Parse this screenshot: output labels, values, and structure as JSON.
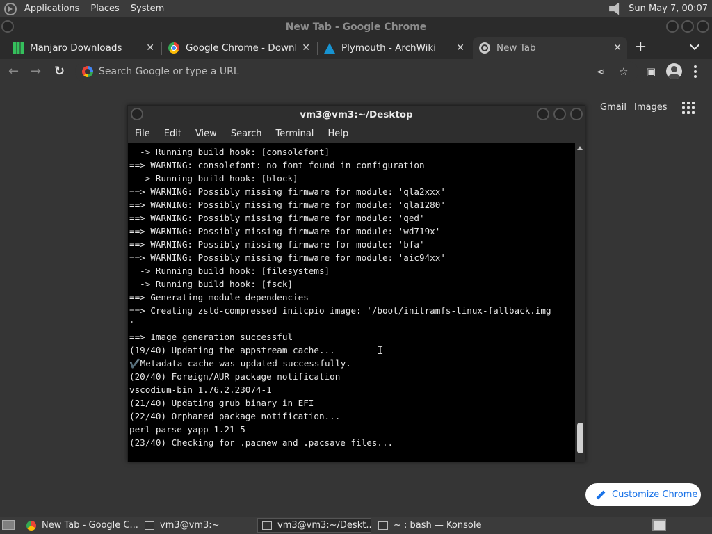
{
  "top_panel": {
    "menus": [
      "Applications",
      "Places",
      "System"
    ],
    "clock": "Sun May 7, 00:07"
  },
  "chrome": {
    "window_title": "New Tab - Google Chrome",
    "tabs": [
      {
        "title": "Manjaro Downloads",
        "icon": "manjaro-logo-icon"
      },
      {
        "title": "Google Chrome - Download",
        "icon": "chrome-logo-icon"
      },
      {
        "title": "Plymouth - ArchWiki",
        "icon": "arch-logo-icon"
      },
      {
        "title": "New Tab",
        "icon": "new-tab-icon",
        "active": true
      }
    ],
    "omnibox_placeholder": "Search Google or type a URL",
    "ntp": {
      "gmail": "Gmail",
      "images": "Images",
      "customize": "Customize Chrome"
    }
  },
  "terminal": {
    "title": "vm3@vm3:~/Desktop",
    "menu": [
      "File",
      "Edit",
      "View",
      "Search",
      "Terminal",
      "Help"
    ],
    "lines": [
      "  -> Running build hook: [consolefont]",
      "==> WARNING: consolefont: no font found in configuration",
      "  -> Running build hook: [block]",
      "==> WARNING: Possibly missing firmware for module: 'qla2xxx'",
      "==> WARNING: Possibly missing firmware for module: 'qla1280'",
      "==> WARNING: Possibly missing firmware for module: 'qed'",
      "==> WARNING: Possibly missing firmware for module: 'wd719x'",
      "==> WARNING: Possibly missing firmware for module: 'bfa'",
      "==> WARNING: Possibly missing firmware for module: 'aic94xx'",
      "  -> Running build hook: [filesystems]",
      "  -> Running build hook: [fsck]",
      "==> Generating module dependencies",
      "==> Creating zstd-compressed initcpio image: '/boot/initramfs-linux-fallback.img",
      "'",
      "==> Image generation successful",
      "(19/40) Updating the appstream cache...",
      "✔️Metadata cache was updated successfully.",
      "(20/40) Foreign/AUR package notification",
      "vscodium-bin 1.76.2.23074-1",
      "(21/40) Updating grub binary in EFI",
      "(22/40) Orphaned package notification...",
      "perl-parse-yapp 1.21-5",
      "(23/40) Checking for .pacnew and .pacsave files..."
    ]
  },
  "taskbar": {
    "tasks": [
      {
        "label": "New Tab - Google C...",
        "icon": "chrome-logo-icon"
      },
      {
        "label": "vm3@vm3:~",
        "icon": "terminal-icon"
      },
      {
        "label": "vm3@vm3:~/Deskt...",
        "icon": "terminal-icon",
        "active": true
      },
      {
        "label": "~ : bash — Konsole",
        "icon": "terminal-icon"
      }
    ]
  }
}
